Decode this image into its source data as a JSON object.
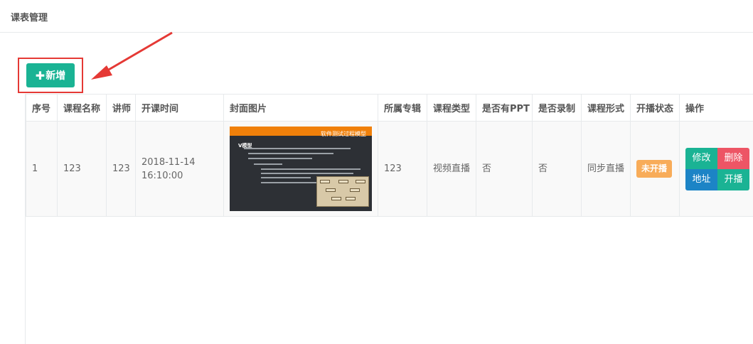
{
  "header": {
    "title": "课表管理"
  },
  "toolbar": {
    "add_label": "新增",
    "add_icon": "plus-icon"
  },
  "table": {
    "columns": [
      "序号",
      "课程名称",
      "讲师",
      "开课时间",
      "封面图片",
      "所属专辑",
      "课程类型",
      "是否有PPT",
      "是否录制",
      "课程形式",
      "开播状态",
      "操作"
    ],
    "rows": [
      {
        "index": "1",
        "name": "123",
        "teacher": "123",
        "start_date": "2018-11-14",
        "start_time": "16:10:00",
        "cover": {
          "title": "软件测试过程模型",
          "heading": "V模型"
        },
        "album": "123",
        "type": "视频直播",
        "has_ppt": "否",
        "recorded": "否",
        "format": "同步直播",
        "status": "未开播",
        "actions": {
          "edit": "修改",
          "delete": "删除",
          "address": "地址",
          "start": "开播"
        }
      }
    ]
  },
  "colors": {
    "primary": "#1ab394",
    "danger": "#ed5565",
    "info": "#1c84c6",
    "warning": "#f8ac59",
    "annotation": "#e53935"
  }
}
